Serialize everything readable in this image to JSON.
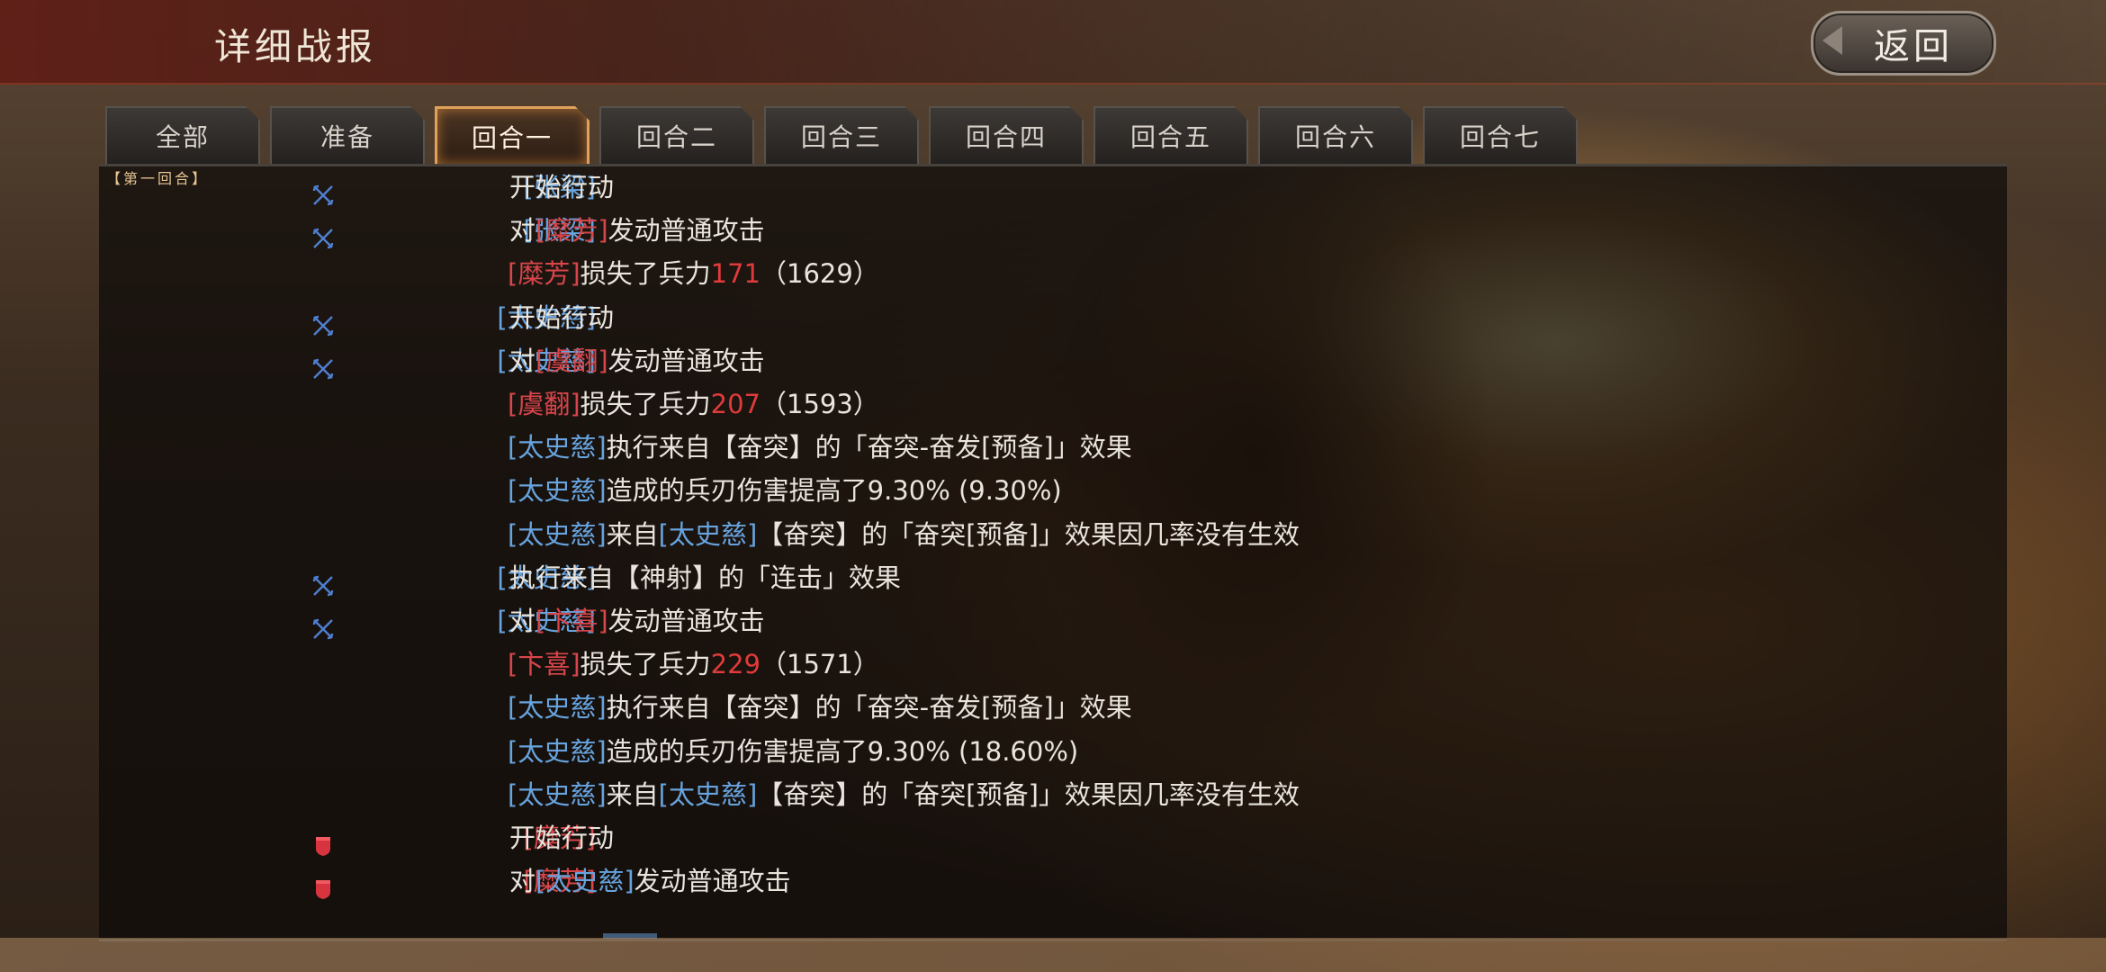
{
  "header": {
    "title": "详细战报",
    "back_label": "返回"
  },
  "tabs": [
    {
      "label": "全部",
      "active": false
    },
    {
      "label": "准备",
      "active": false
    },
    {
      "label": "回合一",
      "active": true
    },
    {
      "label": "回合二",
      "active": false
    },
    {
      "label": "回合三",
      "active": false
    },
    {
      "label": "回合四",
      "active": false
    },
    {
      "label": "回合五",
      "active": false
    },
    {
      "label": "回合六",
      "active": false
    },
    {
      "label": "回合七",
      "active": false
    }
  ],
  "log": {
    "round_label": "【第一回合】",
    "rows": [
      {
        "icon": "bow-icon",
        "actor": "[张梁]",
        "actor_color": "blue",
        "parts": [
          {
            "t": "开始行动",
            "c": "w"
          }
        ]
      },
      {
        "icon": "bow-icon",
        "actor": "[张梁]",
        "actor_color": "blue",
        "parts": [
          {
            "t": "对",
            "c": "w"
          },
          {
            "t": "[糜芳]",
            "c": "r"
          },
          {
            "t": "发动普通攻击",
            "c": "w"
          }
        ]
      },
      {
        "icon": "",
        "actor": "",
        "parts": [
          {
            "t": "[糜芳]",
            "c": "r"
          },
          {
            "t": "损失了兵力",
            "c": "w"
          },
          {
            "t": "171",
            "c": "n"
          },
          {
            "t": "（1629）",
            "c": "w"
          }
        ]
      },
      {
        "icon": "bow-icon",
        "actor": "[太史慈]",
        "actor_color": "blue",
        "parts": [
          {
            "t": "开始行动",
            "c": "w"
          }
        ]
      },
      {
        "icon": "bow-icon",
        "actor": "[太史慈]",
        "actor_color": "blue",
        "parts": [
          {
            "t": "对",
            "c": "w"
          },
          {
            "t": "[虞翻]",
            "c": "r"
          },
          {
            "t": "发动普通攻击",
            "c": "w"
          }
        ]
      },
      {
        "icon": "",
        "actor": "",
        "parts": [
          {
            "t": "[虞翻]",
            "c": "r"
          },
          {
            "t": "损失了兵力",
            "c": "w"
          },
          {
            "t": "207",
            "c": "n"
          },
          {
            "t": "（1593）",
            "c": "w"
          }
        ]
      },
      {
        "icon": "",
        "actor": "",
        "parts": [
          {
            "t": "[太史慈]",
            "c": "b"
          },
          {
            "t": "执行来自【奋突】的「奋突-奋发[预备]」效果",
            "c": "w"
          }
        ]
      },
      {
        "icon": "",
        "actor": "",
        "parts": [
          {
            "t": "[太史慈]",
            "c": "b"
          },
          {
            "t": "造成的兵刃伤害提高了9.30% (9.30%)",
            "c": "w"
          }
        ]
      },
      {
        "icon": "",
        "actor": "",
        "parts": [
          {
            "t": "[太史慈]",
            "c": "b"
          },
          {
            "t": "来自",
            "c": "w"
          },
          {
            "t": "[太史慈]",
            "c": "b"
          },
          {
            "t": "【奋突】的「奋突[预备]」效果因几率没有生效",
            "c": "w"
          }
        ]
      },
      {
        "icon": "bow-icon",
        "actor": "[太史慈]",
        "actor_color": "blue",
        "parts": [
          {
            "t": "执行来自【神射】的「连击」效果",
            "c": "w"
          }
        ]
      },
      {
        "icon": "bow-icon",
        "actor": "[太史慈]",
        "actor_color": "blue",
        "parts": [
          {
            "t": "对",
            "c": "w"
          },
          {
            "t": "[卞喜]",
            "c": "r"
          },
          {
            "t": "发动普通攻击",
            "c": "w"
          }
        ]
      },
      {
        "icon": "",
        "actor": "",
        "parts": [
          {
            "t": "[卞喜]",
            "c": "r"
          },
          {
            "t": "损失了兵力",
            "c": "w"
          },
          {
            "t": "229",
            "c": "n"
          },
          {
            "t": "（1571）",
            "c": "w"
          }
        ]
      },
      {
        "icon": "",
        "actor": "",
        "parts": [
          {
            "t": "[太史慈]",
            "c": "b"
          },
          {
            "t": "执行来自【奋突】的「奋突-奋发[预备]」效果",
            "c": "w"
          }
        ]
      },
      {
        "icon": "",
        "actor": "",
        "parts": [
          {
            "t": "[太史慈]",
            "c": "b"
          },
          {
            "t": "造成的兵刃伤害提高了9.30% (18.60%)",
            "c": "w"
          }
        ]
      },
      {
        "icon": "",
        "actor": "",
        "parts": [
          {
            "t": "[太史慈]",
            "c": "b"
          },
          {
            "t": "来自",
            "c": "w"
          },
          {
            "t": "[太史慈]",
            "c": "b"
          },
          {
            "t": "【奋突】的「奋突[预备]」效果因几率没有生效",
            "c": "w"
          }
        ]
      },
      {
        "icon": "shield-icon",
        "actor": "[糜芳]",
        "actor_color": "red",
        "parts": [
          {
            "t": "开始行动",
            "c": "w"
          }
        ]
      },
      {
        "icon": "shield-icon",
        "actor": "[糜芳]",
        "actor_color": "red",
        "parts": [
          {
            "t": "对",
            "c": "w"
          },
          {
            "t": "[太史慈]",
            "c": "b"
          },
          {
            "t": "发动普通攻击",
            "c": "w"
          }
        ]
      }
    ]
  },
  "colors": {
    "ally": "#67a3de",
    "enemy": "#d8454a",
    "damage": "#e03b3b",
    "round": "#e7c692",
    "active_tab": "#e0a15a"
  }
}
